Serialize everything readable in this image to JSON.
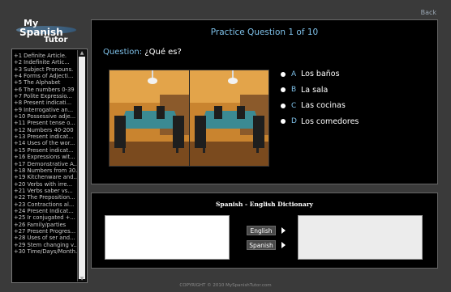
{
  "logo": {
    "line1": "My",
    "line2": "Spanish",
    "line3": "Tutor"
  },
  "back_link": "Back",
  "sidebar": {
    "items": [
      "+1 Definite Article.",
      "+2 Indefinite Artic...",
      "+3 Subject Pronouns.",
      "+4 Forms of Adjecti...",
      "+5 The Alphabet",
      "+6 The numbers 0-39",
      "+7 Polite Expressio...",
      "+8 Present indicati...",
      "+9 Interrogative an...",
      "+10 Possessive adje...",
      "+11 Present tense o...",
      "+12 Numbers 40-200",
      "+13 Present indicat...",
      "+14 Uses of the wor...",
      "+15 Present indicat...",
      "+16 Expressions wit...",
      "+17 Demonstrative A...",
      "+18 Numbers from 30...",
      "+19 Kitchenware and...",
      "+20 Verbs with irre...",
      "+21 Verbs saber vs...",
      "+22 The Preposition...",
      "+23 Contractions al...",
      "+24 Present Indicat...",
      "+25 Ir conjugated +...",
      "+26 Family/parties",
      "+27 Present Progres...",
      "+28 Uses of ser and...",
      "+29 Stem changing v...",
      "+30 Time/Days/Month..."
    ]
  },
  "question_panel": {
    "title": "Practice Question 1 of 10",
    "question_label": "Question:",
    "question_text": "¿Qué es?",
    "answers": [
      {
        "letter": "A",
        "text": "Los baños"
      },
      {
        "letter": "B",
        "text": "La sala"
      },
      {
        "letter": "C",
        "text": "Las cocinas"
      },
      {
        "letter": "D",
        "text": "Los comedores"
      }
    ]
  },
  "dictionary": {
    "title": "Spanish - English Dictionary",
    "english_button": "English",
    "spanish_button": "Spanish"
  },
  "footer": {
    "copyright": "COPYRIGHT © 2010 MySpanishTutor.com"
  },
  "colors": {
    "accent": "#7ec0e8",
    "panel_bg": "#000000",
    "page_bg": "#3a3a3a"
  }
}
